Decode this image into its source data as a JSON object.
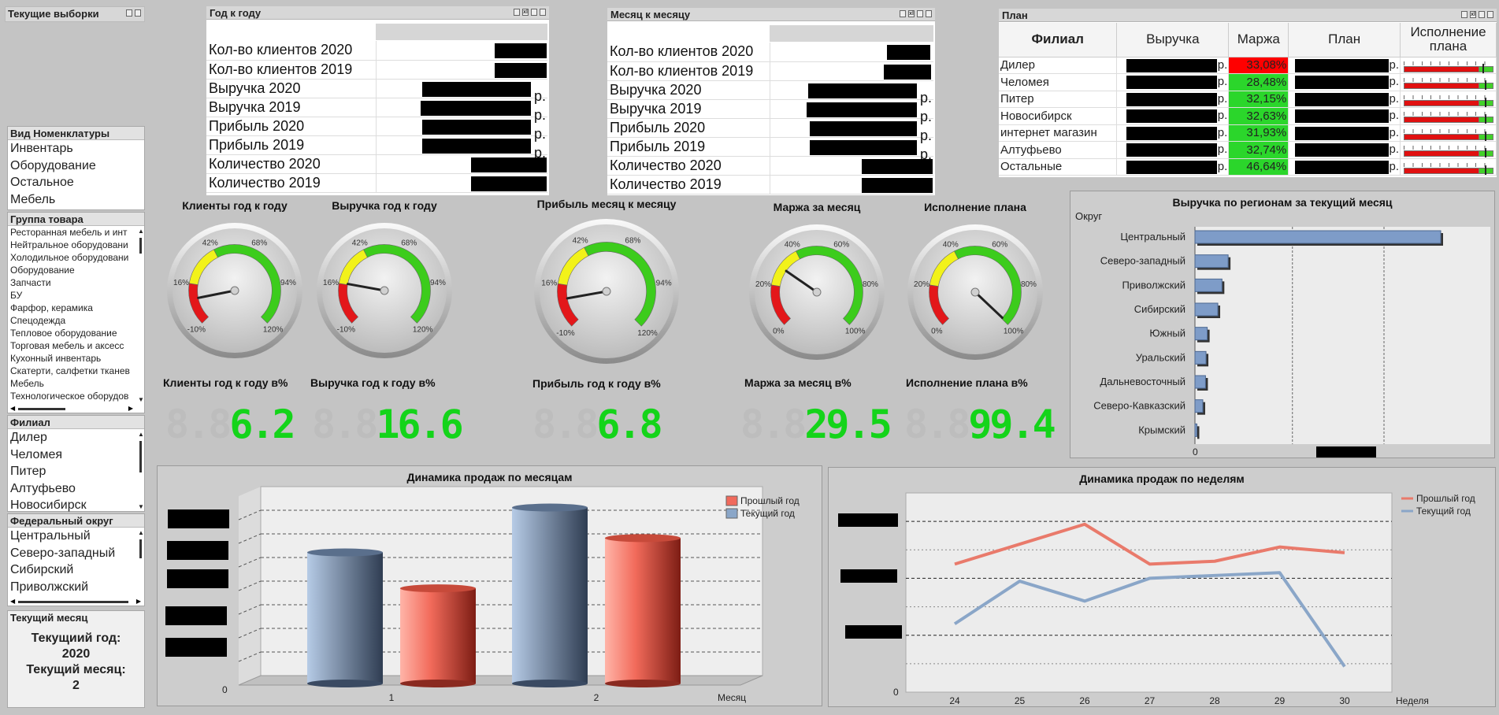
{
  "current_selections": {
    "title": "Текущие выборки"
  },
  "year_over_year": {
    "title": "Год к году",
    "rows": [
      {
        "label": "Кол-во клиентов 2020"
      },
      {
        "label": "Кол-во клиентов 2019"
      },
      {
        "label": "Выручка 2020",
        "unit": "р."
      },
      {
        "label": "Выручка 2019",
        "unit": "р."
      },
      {
        "label": "Прибыль 2020",
        "unit": "р."
      },
      {
        "label": "Прибыль 2019",
        "unit": "р."
      },
      {
        "label": "Количество 2020"
      },
      {
        "label": "Количество 2019"
      }
    ]
  },
  "month_over_month": {
    "title": "Месяц к месяцу",
    "rows": [
      {
        "label": "Кол-во клиентов 2020"
      },
      {
        "label": "Кол-во клиентов 2019"
      },
      {
        "label": "Выручка 2020",
        "unit": "р."
      },
      {
        "label": "Выручка 2019",
        "unit": "р."
      },
      {
        "label": "Прибыль 2020",
        "unit": "р."
      },
      {
        "label": "Прибыль 2019",
        "unit": "р."
      },
      {
        "label": "Количество 2020"
      },
      {
        "label": "Количество 2019"
      }
    ]
  },
  "plan": {
    "title": "План",
    "headers": [
      "Филиал",
      "Выручка",
      "Маржа",
      "План",
      "Исполнение плана"
    ],
    "unit": "р.",
    "rows": [
      {
        "branch": "Дилер",
        "margin": "33,08%",
        "margin_color": "#ff0000",
        "progress": 0.88
      },
      {
        "branch": "Челомея",
        "margin": "28,48%",
        "margin_color": "#2bd62b",
        "progress": 0.9
      },
      {
        "branch": "Питер",
        "margin": "32,15%",
        "margin_color": "#2bd62b",
        "progress": 0.9
      },
      {
        "branch": "Новосибирск",
        "margin": "32,63%",
        "margin_color": "#2bd62b",
        "progress": 0.9
      },
      {
        "branch": "интернет магазин",
        "margin": "31,93%",
        "margin_color": "#2bd62b",
        "progress": 0.9
      },
      {
        "branch": "Алтуфьево",
        "margin": "32,74%",
        "margin_color": "#2bd62b",
        "progress": 0.9
      },
      {
        "branch": "Остальные",
        "margin": "46,64%",
        "margin_color": "#2bd62b",
        "progress": 0.9
      }
    ]
  },
  "nomenclature": {
    "title": "Вид Номенклатуры",
    "items": [
      "Инвентарь",
      "Оборудование",
      "Остальное",
      "Мебель"
    ]
  },
  "product_group": {
    "title": "Группа товара",
    "items": [
      "Ресторанная мебель и инт",
      "Нейтральное оборудовани",
      "Холодильное оборудовани",
      "Оборудование",
      "Запчасти",
      "БУ",
      "Фарфор, керамика",
      "Спецодежда",
      "Тепловое оборудование",
      "Торговая мебель и аксесс",
      "Кухонный инвентарь",
      "Скатерти, салфетки тканев",
      "Мебель",
      "Технологическое оборудов"
    ]
  },
  "branch_list": {
    "title": "Филиал",
    "items": [
      "Дилер",
      "Челомея",
      "Питер",
      "Алтуфьево",
      "Новосибирск"
    ]
  },
  "federal_district": {
    "title": "Федеральный округ",
    "items": [
      "Центральный",
      "Северо-западный",
      "Сибирский",
      "Приволжский"
    ]
  },
  "current_month": {
    "title": "Текущий месяц",
    "year_label": "Текущиий год:",
    "year_value": "2020",
    "month_label": "Текущий месяц:",
    "month_value": "2"
  },
  "gauges": [
    {
      "title": "Клиенты год к году",
      "ticks": [
        "-10%",
        "16%",
        "42%",
        "68%",
        "94%",
        "120%"
      ],
      "value": 6.2,
      "min": -10,
      "max": 120,
      "kpi_title": "Клиенты год к году в%",
      "kpi_value": "6.2"
    },
    {
      "title": "Выручка год к году",
      "ticks": [
        "-10%",
        "16%",
        "42%",
        "68%",
        "94%",
        "120%"
      ],
      "value": 16.6,
      "min": -10,
      "max": 120,
      "kpi_title": "Выручка год к году в%",
      "kpi_value": "16.6"
    },
    {
      "title": "Прибыль месяц к месяцу",
      "ticks": [
        "-10%",
        "16%",
        "42%",
        "68%",
        "94%",
        "120%"
      ],
      "value": 6.8,
      "min": -10,
      "max": 120,
      "kpi_title": "Прибыль год к году в%",
      "kpi_value": "6.8"
    },
    {
      "title": "Маржа за месяц",
      "ticks": [
        "0%",
        "20%",
        "40%",
        "60%",
        "80%",
        "100%"
      ],
      "value": 29.5,
      "min": 0,
      "max": 100,
      "kpi_title": "Маржа за месяц в%",
      "kpi_value": "29.5"
    },
    {
      "title": "Исполнение плана",
      "ticks": [
        "0%",
        "20%",
        "40%",
        "60%",
        "80%",
        "100%"
      ],
      "value": 99.4,
      "min": 0,
      "max": 100,
      "kpi_title": "Исполнение плана в%",
      "kpi_value": "99.4"
    }
  ],
  "chart_data": [
    {
      "type": "bar",
      "title": "Выручка по регионам за текущий месяц",
      "dimension_label": "Округ",
      "categories": [
        "Центральный",
        "Северо-западный",
        "Приволжский",
        "Сибирский",
        "Южный",
        "Уральский",
        "Дальневосточный",
        "Северо-Кавказский",
        "Крымский"
      ],
      "values": [
        100,
        13.5,
        11,
        9.3,
        5,
        4.5,
        4.3,
        3.2,
        0.8
      ],
      "x_tick_label": "0",
      "color": "#7e9cc8"
    },
    {
      "type": "bar",
      "title": "Динамика продаж по месяцам",
      "xlabel": "Месяц",
      "categories": [
        "1",
        "2"
      ],
      "series": [
        {
          "name": "Прошлый год",
          "values": [
            53,
            81
          ],
          "color": "#f06a5c"
        },
        {
          "name": "Текущий год",
          "values": [
            73,
            98
          ],
          "color": "#8aa6c8"
        }
      ],
      "y_zero_label": "0"
    },
    {
      "type": "line",
      "title": "Динамика продаж по неделям",
      "xlabel": "Неделя",
      "x": [
        "24",
        "25",
        "26",
        "27",
        "28",
        "29",
        "30"
      ],
      "series": [
        {
          "name": "Прошлый год",
          "values": [
            45,
            52,
            59,
            45,
            46,
            51,
            49
          ],
          "color": "#e97a6b"
        },
        {
          "name": "Текущий год",
          "values": [
            24,
            39,
            32,
            40,
            41,
            42,
            9
          ],
          "color": "#8aa6c8"
        }
      ],
      "y_zero_label": "0"
    }
  ]
}
